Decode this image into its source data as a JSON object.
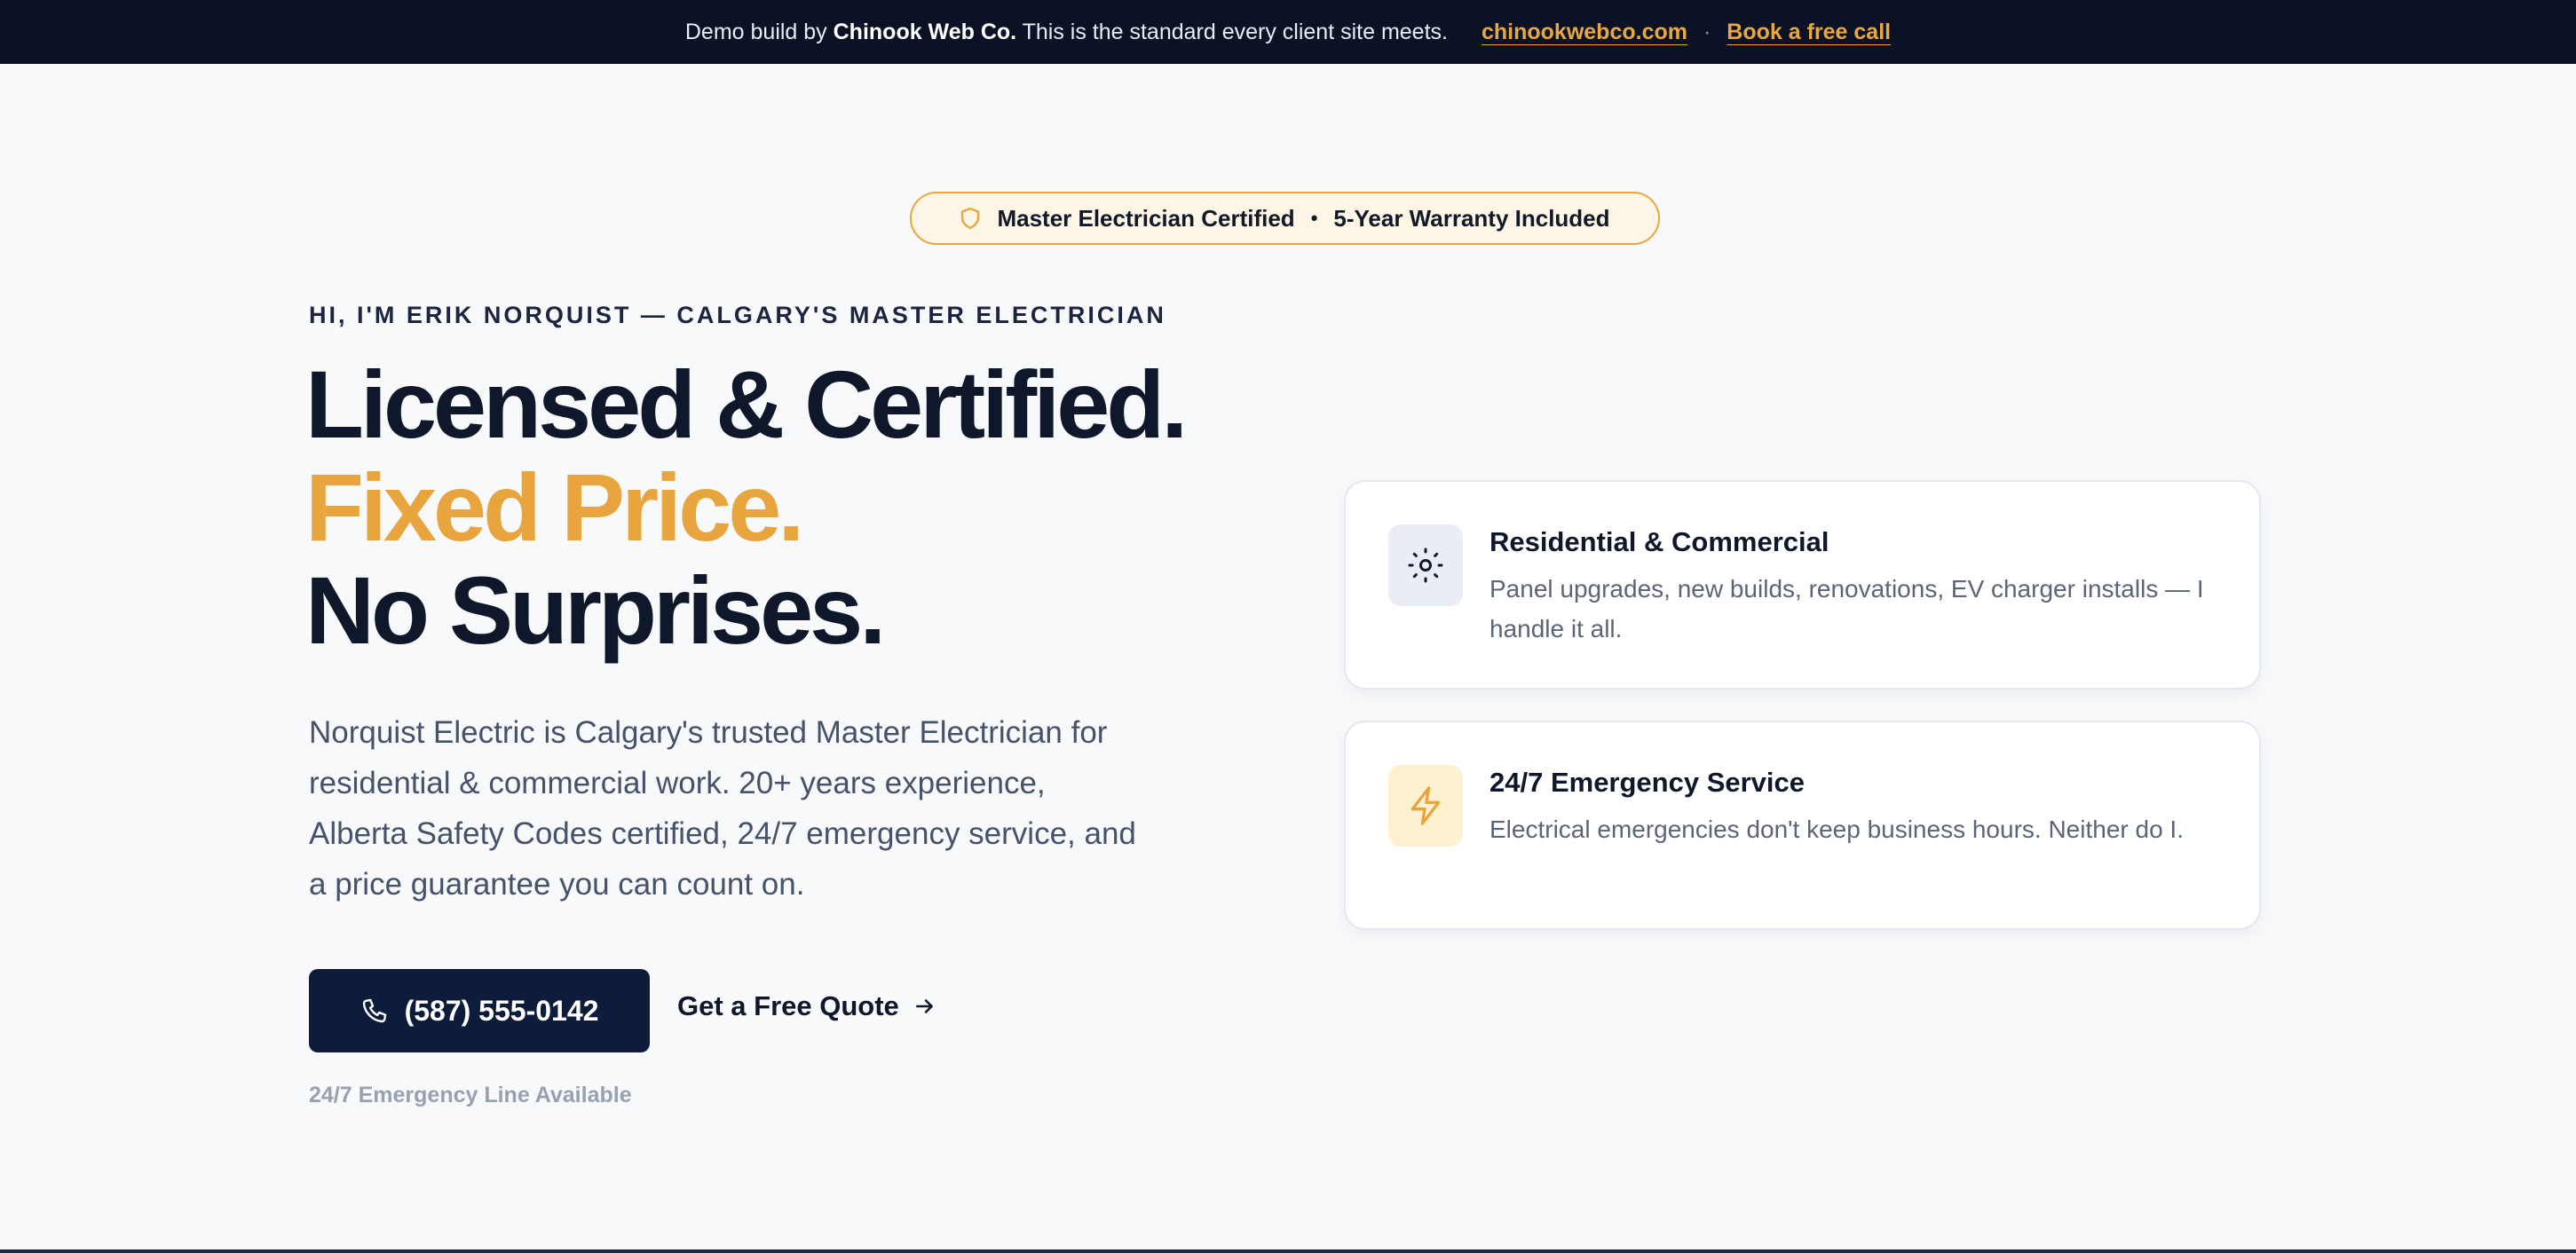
{
  "topbar": {
    "prefix": "Demo build by ",
    "brand": "Chinook Web Co.",
    "message": " This is the standard every client site meets.",
    "site_link": "chinookwebco.com",
    "separator": "·",
    "call_link": "Book a free call"
  },
  "badge": {
    "icon": "shield-icon",
    "left_text": "Master Electrician Certified",
    "bullet": "•",
    "right_text": "5-Year Warranty Included"
  },
  "hero": {
    "eyebrow": "HI, I'M ERIK NORQUIST — CALGARY'S MASTER ELECTRICIAN",
    "line1": "Licensed & Certified.",
    "line2": "Fixed Price.",
    "line3": "No Surprises.",
    "lead": "Norquist Electric is Calgary's trusted Master Electrician for residential & commercial work. 20+ years experience, Alberta Safety Codes certified, 24/7 emergency service, and a price guarantee you can count on.",
    "phone_button": "(587) 555-0142",
    "quote_link": "Get a Free Quote",
    "emergency_note": "24/7 Emergency Line Available"
  },
  "cards": [
    {
      "icon": "sun-gear-icon",
      "title": "Residential & Commercial",
      "description": "Panel upgrades, new builds, renovations, EV charger installs — I handle it all."
    },
    {
      "icon": "lightning-bolt-icon",
      "title": "24/7 Emergency Service",
      "description": "Electrical emergencies don't keep business hours. Neither do I."
    }
  ],
  "colors": {
    "accent": "#e8a53d",
    "navy": "#0e1c3c",
    "topbar_bg": "#0b1226"
  }
}
